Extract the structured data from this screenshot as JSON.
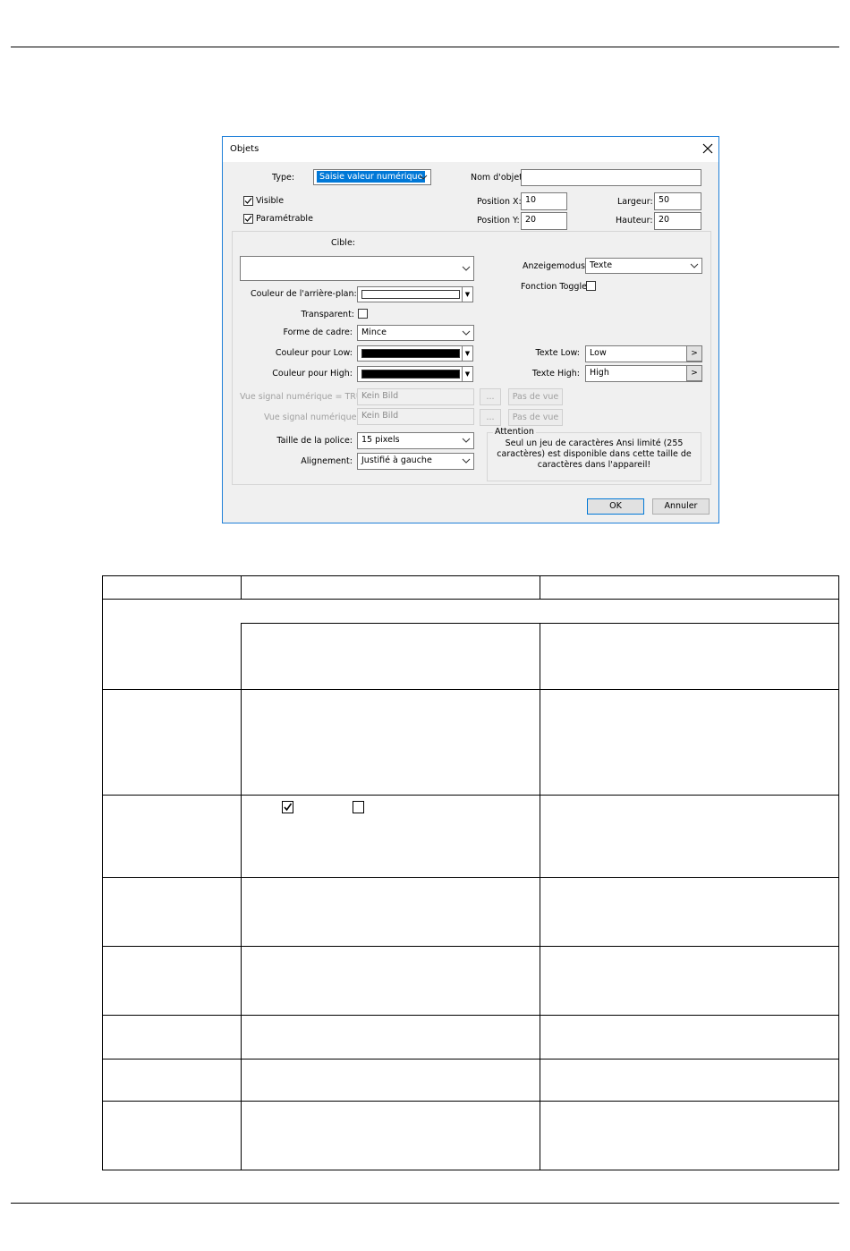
{
  "dialog": {
    "title": "Objets",
    "type_label": "Type:",
    "type_value": "Saisie valeur numérique",
    "name_label": "Nom d'objet:",
    "name_value": "",
    "visible_label": "Visible",
    "visible_checked": true,
    "param_label": "Paramétrable",
    "param_checked": true,
    "posx_label": "Position X:",
    "posx_value": "10",
    "posy_label": "Position Y:",
    "posy_value": "20",
    "width_label": "Largeur:",
    "width_value": "50",
    "height_label": "Hauteur:",
    "height_value": "20",
    "target_label": "Cible:",
    "target_value": "",
    "display_mode_label": "Anzeigemodus:",
    "display_mode_value": "Texte",
    "toggle_label": "Fonction Toggle:",
    "bg_color_label": "Couleur de l'arrière-plan:",
    "bg_color": "#ffffff",
    "transparent_label": "Transparent:",
    "frame_label": "Forme de cadre:",
    "frame_value": "Mince",
    "color_low_label": "Couleur pour Low:",
    "color_low": "#000000",
    "color_high_label": "Couleur pour High:",
    "color_high": "#000000",
    "text_low_label": "Texte Low:",
    "text_low_value": "Low",
    "text_high_label": "Texte High:",
    "text_high_value": "High",
    "picker_button": ">",
    "view_true_label": "Vue signal numérique = TRUE",
    "view_true_value": "Kein Bild",
    "view_false_label": "Vue signal numérique =",
    "view_false_value": "Kein Bild",
    "browse_label": "...",
    "no_view_label": "Pas de vue",
    "font_size_label": "Taille de la police:",
    "font_size_value": "15 pixels",
    "align_label": "Alignement:",
    "align_value": "Justifié à gauche",
    "attention_title": "Attention",
    "attention_text": "Seul un jeu de caractères Ansi limité (255 caractères) est disponible dans cette taille de caractères dans l'appareil!",
    "ok_label": "OK",
    "cancel_label": "Annuler"
  },
  "colors": {
    "accent": "#0078d7",
    "dialog_bg": "#f0f0f0",
    "border_blue": "#1e7fd8"
  },
  "icons": [
    "close-icon",
    "chevron-down-icon",
    "checkbox-checked-icon",
    "checkbox-unchecked-icon"
  ]
}
